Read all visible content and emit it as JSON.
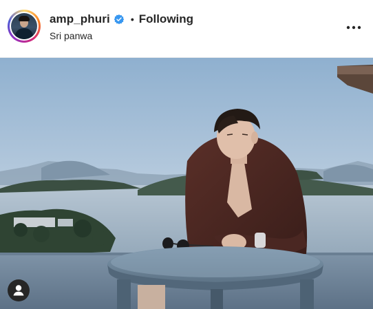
{
  "post": {
    "username": "amp_phuri",
    "verified_icon": "verified-badge-icon",
    "separator": "•",
    "follow_status": "Following",
    "location": "Sri panwa"
  },
  "icons": {
    "more": "more-options-icon",
    "user_tag": "user-tag-icon"
  },
  "colors": {
    "verified": "#3897f0",
    "text": "#262626"
  }
}
